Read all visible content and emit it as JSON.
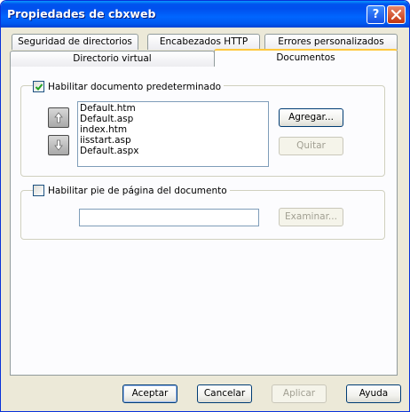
{
  "window": {
    "title": "Propiedades de cbxweb",
    "help_button": "?"
  },
  "tabs": {
    "row_back": [
      "Seguridad de directorios",
      "Encabezados HTTP",
      "Errores personalizados"
    ],
    "row_front": [
      "Directorio virtual",
      "Documentos"
    ],
    "active": "Documentos"
  },
  "default_doc": {
    "checkbox_label": "Habilitar documento predeterminado",
    "checked": true,
    "files": [
      "Default.htm",
      "Default.asp",
      "index.htm",
      "iisstart.asp",
      "Default.aspx"
    ],
    "add_button": "Agregar...",
    "remove_button": "Quitar"
  },
  "footer_doc": {
    "checkbox_label": "Habilitar pie de página del documento",
    "checked": false,
    "path_value": "",
    "browse_button": "Examinar..."
  },
  "dialog_buttons": {
    "ok": "Aceptar",
    "cancel": "Cancelar",
    "apply": "Aplicar",
    "help": "Ayuda"
  },
  "colors": {
    "titlebar": "#0054e3",
    "tab_highlight": "#ffc83c",
    "dialog_bg": "#ece9d8"
  }
}
